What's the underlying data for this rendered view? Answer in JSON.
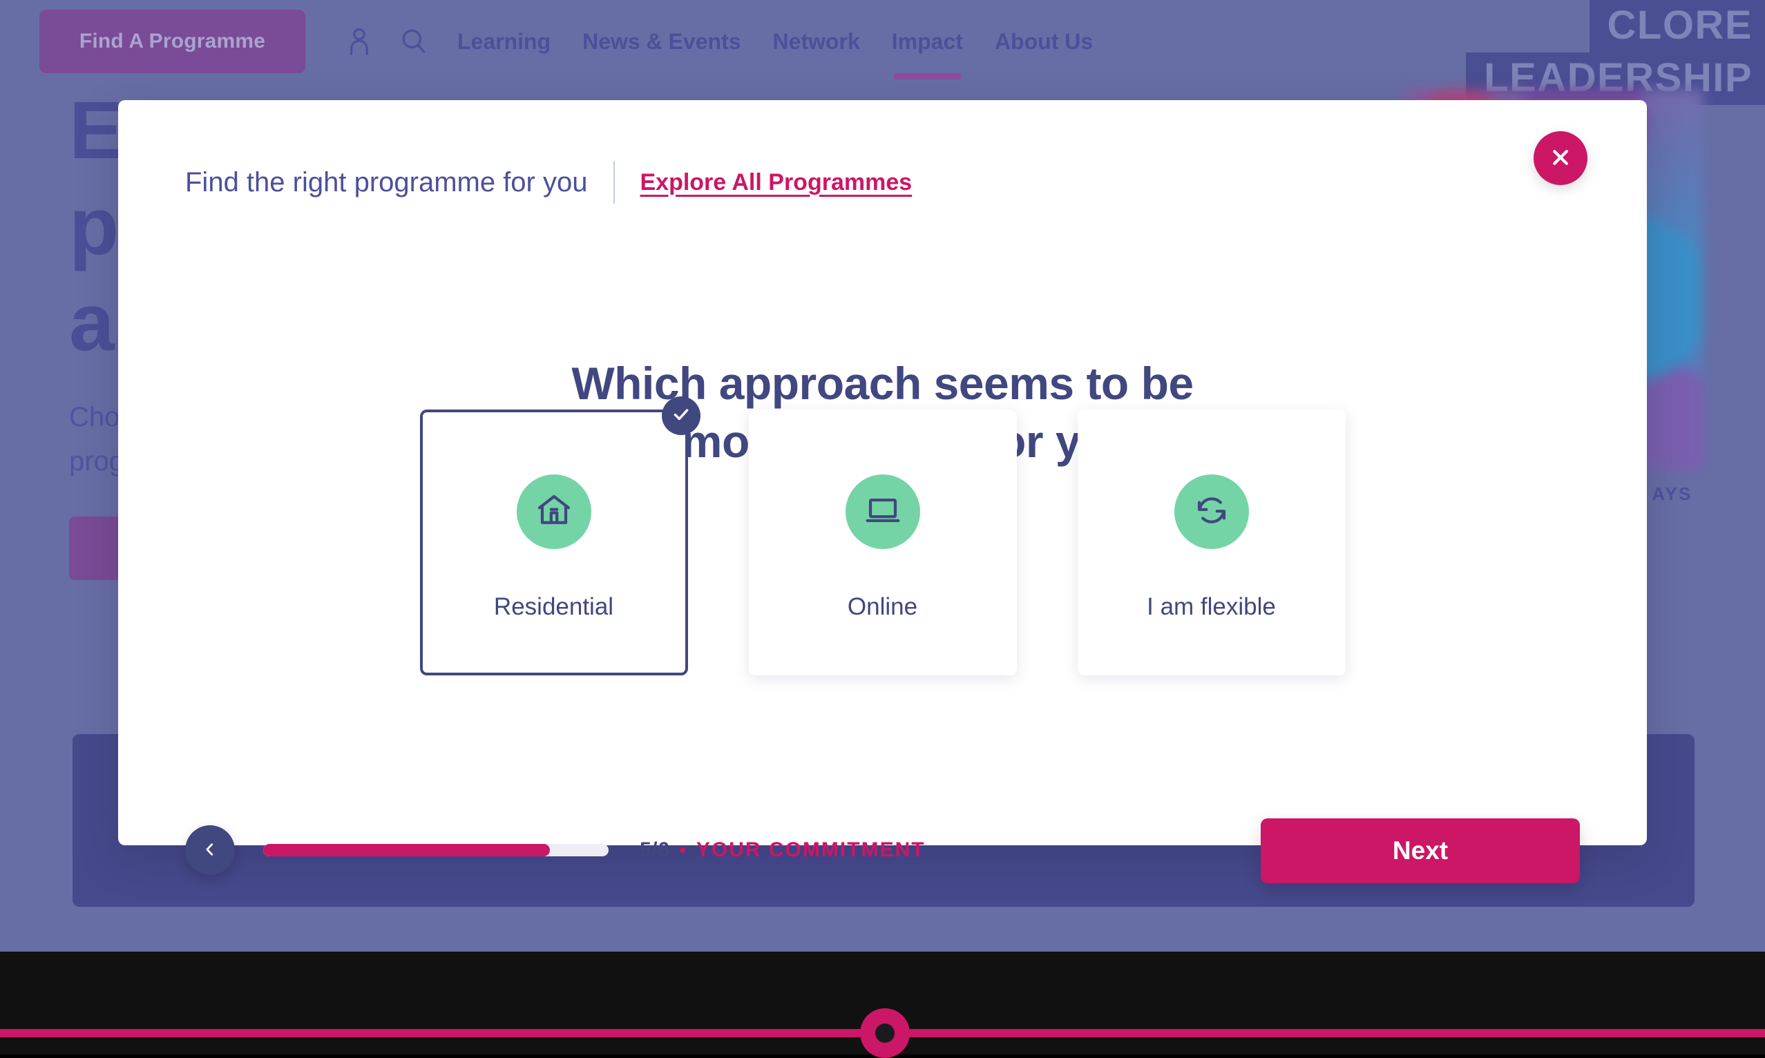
{
  "background": {
    "nav": {
      "find_programme_label": "Find A Programme",
      "icons": [
        {
          "name": "account-icon"
        },
        {
          "name": "search-icon"
        }
      ],
      "links": [
        {
          "label": "Learning",
          "active": false
        },
        {
          "label": "News & Events",
          "active": false
        },
        {
          "label": "Network",
          "active": false
        },
        {
          "label": "Impact",
          "active": true
        },
        {
          "label": "About Us",
          "active": false
        }
      ]
    },
    "logo": {
      "line1": "CLORE",
      "line2": "LEADERSHIP"
    },
    "hero": {
      "title_line1": "Ex",
      "title_line2": "p",
      "title_line3": "an",
      "sub_line1": "Cho",
      "sub_line2": "prog",
      "image_caption": "AYS"
    }
  },
  "modal": {
    "header": {
      "title": "Find the right programme for you",
      "explore_link": "Explore All Programmes",
      "close_icon": "close-icon"
    },
    "question": {
      "line1": "Which approach seems to be",
      "line2": "the most suitable for you?"
    },
    "options": [
      {
        "label": "Residential",
        "icon": "house-icon",
        "selected": true
      },
      {
        "label": "Online",
        "icon": "laptop-icon",
        "selected": false
      },
      {
        "label": "I am flexible",
        "icon": "sync-arrows-icon",
        "selected": false
      }
    ],
    "footer": {
      "back_icon": "chevron-left-icon",
      "progress_percent": 83,
      "step_count": "5/6",
      "step_separator": "•",
      "step_label": "YOUR COMMITMENT",
      "next_label": "Next"
    }
  },
  "colors": {
    "page_background": "#676ea5",
    "panel_dark": "#46498c",
    "navy": "#41477f",
    "pink": "#cc1666",
    "green": "#74d4a6",
    "purple_button": "#7a4b96"
  }
}
